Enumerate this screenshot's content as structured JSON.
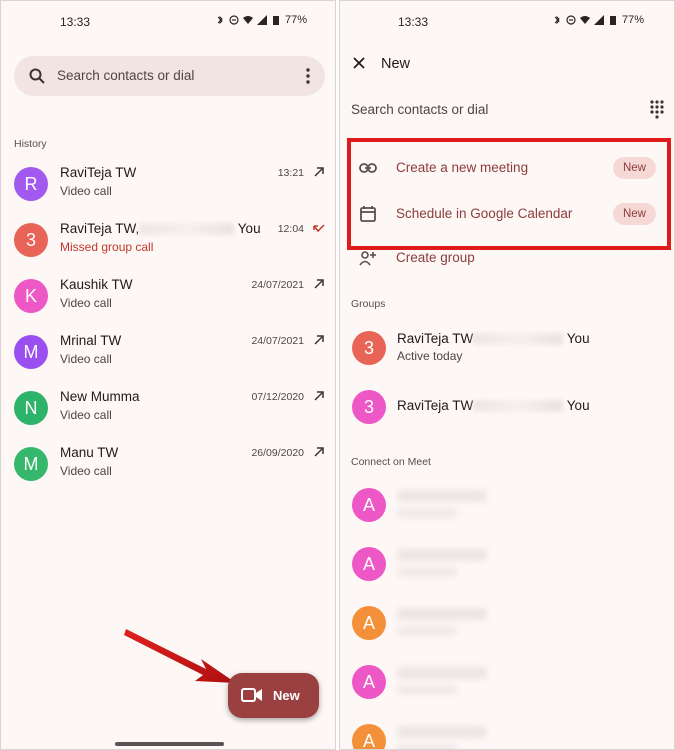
{
  "left": {
    "status": {
      "time": "13:33",
      "battery": "77%"
    },
    "search": {
      "placeholder": "Search contacts or dial"
    },
    "history_label": "History",
    "history": [
      {
        "initial": "R",
        "name": "RaviTeja TW",
        "sub": "Video call",
        "time": "13:21",
        "color": "#a259f0",
        "missed": false
      },
      {
        "initial": "3",
        "name": "RaviTeja TW,",
        "name_suffix": "You",
        "sub": "Missed group call",
        "time": "12:04",
        "color": "#e86457",
        "missed": true
      },
      {
        "initial": "K",
        "name": "Kaushik TW",
        "sub": "Video call",
        "time": "24/07/2021",
        "color": "#ee57c6",
        "missed": false
      },
      {
        "initial": "M",
        "name": "Mrinal TW",
        "sub": "Video call",
        "time": "24/07/2021",
        "color": "#9a4ff0",
        "missed": false
      },
      {
        "initial": "N",
        "name": "New Mumma",
        "sub": "Video call",
        "time": "07/12/2020",
        "color": "#2eb36a",
        "missed": false
      },
      {
        "initial": "M",
        "name": "Manu TW",
        "sub": "Video call",
        "time": "26/09/2020",
        "color": "#35b86b",
        "missed": false
      }
    ],
    "fab_label": "New"
  },
  "right": {
    "status": {
      "time": "13:33",
      "battery": "77%"
    },
    "title": "New",
    "search_placeholder": "Search contacts or dial",
    "actions": [
      {
        "icon": "link-icon",
        "label": "Create a new meeting",
        "badge": "New"
      },
      {
        "icon": "calendar-icon",
        "label": "Schedule in Google Calendar",
        "badge": "New"
      },
      {
        "icon": "add-group-icon",
        "label": "Create group",
        "badge": ""
      }
    ],
    "groups_label": "Groups",
    "groups": [
      {
        "initial": "3",
        "name": "RaviTeja TW",
        "name_suffix": "You",
        "sub": "Active today",
        "color": "#e86457"
      },
      {
        "initial": "3",
        "name": "RaviTeja TW",
        "name_suffix": "You",
        "sub": "",
        "color": "#ee57c6"
      }
    ],
    "connect_label": "Connect on Meet",
    "contacts": [
      {
        "initial": "A",
        "color": "#ee57c6"
      },
      {
        "initial": "A",
        "color": "#ee57c6"
      },
      {
        "initial": "A",
        "color": "#f5903a"
      },
      {
        "initial": "A",
        "color": "#ee57c6"
      },
      {
        "initial": "A",
        "color": "#f5903a"
      }
    ]
  },
  "colors": {
    "accent": "#8c3d3b",
    "fab": "#9b4040",
    "highlight": "#e01a1a",
    "badge_bg": "#f6d9d7"
  }
}
